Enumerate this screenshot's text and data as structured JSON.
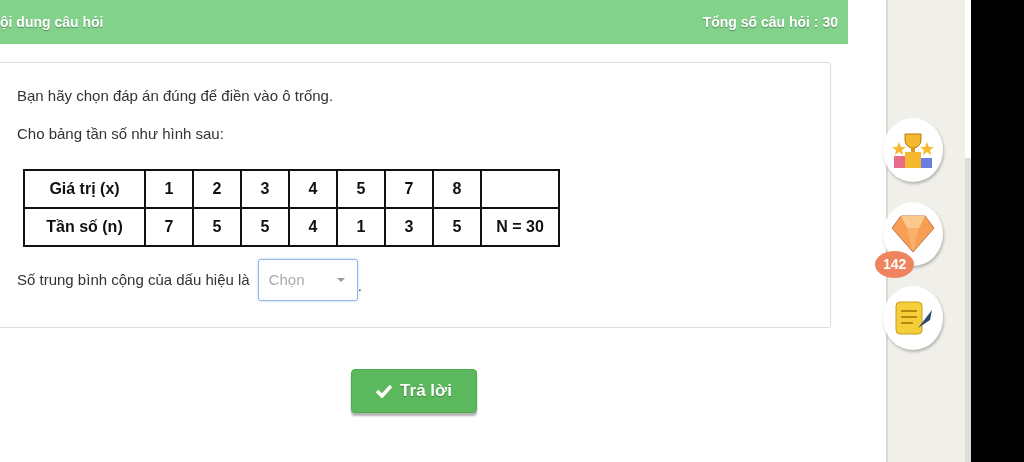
{
  "header": {
    "title": "ội dung câu hỏi",
    "total": "Tổng số câu hỏi : 30"
  },
  "question": {
    "lines": [
      "Bạn hãy chọn đáp án đúng để điền vào ô trống.",
      "Cho bảng tần số như hình sau:"
    ],
    "table": {
      "rows": [
        [
          "Giá trị (x)",
          "1",
          "2",
          "3",
          "4",
          "5",
          "7",
          "8",
          ""
        ],
        [
          "Tần số (n)",
          "7",
          "5",
          "5",
          "4",
          "1",
          "3",
          "5",
          "N = 30"
        ]
      ]
    },
    "fill": {
      "prefix": "Số trung bình cộng của dấu hiệu là",
      "placeholder": "Chọn",
      "suffix": "."
    }
  },
  "submit": {
    "label": "Trả lời"
  },
  "side_badges": [
    {
      "kind": "trophy"
    },
    {
      "kind": "gem",
      "count": "142"
    },
    {
      "kind": "scroll"
    }
  ]
}
